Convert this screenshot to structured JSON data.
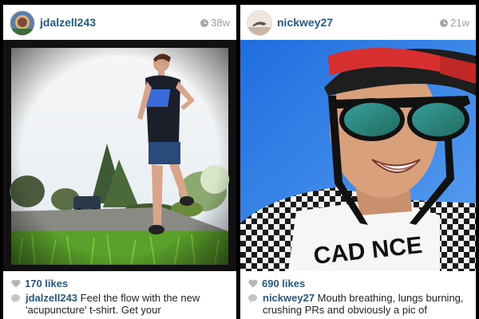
{
  "posts": [
    {
      "username": "jdalzell243",
      "time_ago": "38w",
      "likes": "170 likes",
      "caption_user": "jdalzell243",
      "caption_text": "Feel the flow with the new 'acupuncture' t-shirt. Get your"
    },
    {
      "username": "nickwey27",
      "time_ago": "21w",
      "likes": "690 likes",
      "caption_user": "nickwey27",
      "caption_text": "Mouth breathing, lungs burning, crushing PRs and obviously a pic of",
      "shirt_text": "CAD  NCE"
    }
  ],
  "colors": {
    "link_blue": "#235a8a",
    "muted_gray": "#9a9a9a",
    "sky_blue": "#2f7be0"
  },
  "icons": [
    "clock-icon",
    "heart-icon",
    "comment-bubble-icon"
  ]
}
